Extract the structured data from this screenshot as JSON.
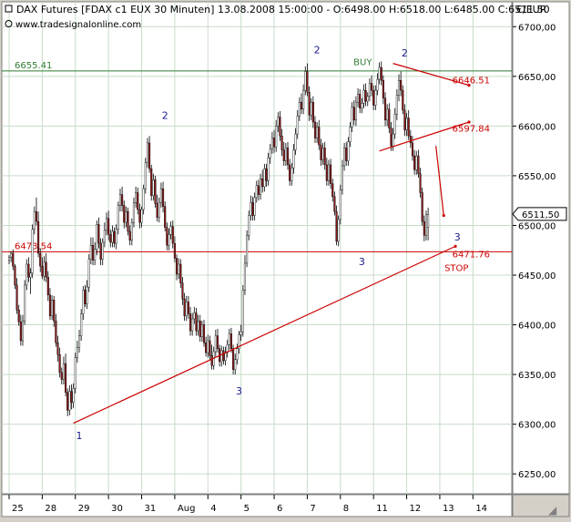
{
  "header": {
    "title": "DAX Futures [FDAX c1 EUX  30 Minuten] 13.08.2008 15:00:00 - O:6498.00 H:6518.00 L:6485.00 C:6511.50",
    "watermark": "www.tradesignalonline.com",
    "currency_label": "€/EUR"
  },
  "colors": {
    "background": "#ffffff",
    "frame": "#d4d0c8",
    "grid": "#c8dcc8",
    "candle_up": "#ffffff",
    "candle_down": "#8b1a1a",
    "candle_wick": "#000000",
    "resistance_line": "#2e7d32",
    "support_line": "#cc0000",
    "wave_label": "#1a1a8c",
    "buy_label": "#2e7d32",
    "level_label": "#cc0000"
  },
  "chart_data": {
    "type": "candlestick",
    "title": "DAX Futures [FDAX c1 EUX  30 Minuten]",
    "ylabel": "€/EUR",
    "ylim": [
      6230,
      6725
    ],
    "y_ticks": [
      6250,
      6300,
      6350,
      6400,
      6450,
      6500,
      6550,
      6600,
      6650,
      6700
    ],
    "y_tick_labels": [
      "6250,00",
      "6300,00",
      "6350,00",
      "6400,00",
      "6450,00",
      "6500,00",
      "6550,00",
      "6600,00",
      "6650,00",
      "6700,00"
    ],
    "x_labels": [
      "25",
      "28",
      "29",
      "30",
      "31",
      "Aug",
      "4",
      "5",
      "6",
      "7",
      "8",
      "11",
      "12",
      "13",
      "14"
    ],
    "x_label_index": [
      0,
      17,
      34,
      51,
      68,
      85,
      102,
      119,
      136,
      153,
      170,
      187,
      204,
      221,
      238
    ],
    "grid": true,
    "last_price": {
      "value": 6511.5,
      "label": "6511,50"
    },
    "horizontal_levels": [
      {
        "value": 6655.41,
        "label": "6655.41",
        "kind": "resistance"
      },
      {
        "value": 6473.54,
        "label": "6473.54",
        "kind": "support"
      }
    ],
    "trendlines": [
      {
        "name": "upper-support-trendline",
        "from": {
          "i": 33,
          "y": 6301
        },
        "to": {
          "i": 229,
          "y": 6479
        },
        "kind": "support"
      },
      {
        "name": "short-trendline-top",
        "from": {
          "i": 197,
          "y": 6663
        },
        "to": {
          "i": 236,
          "y": 6641
        },
        "kind": "support"
      },
      {
        "name": "short-trendline-mid",
        "from": {
          "i": 190,
          "y": 6575
        },
        "to": {
          "i": 236,
          "y": 6604
        },
        "kind": "support"
      },
      {
        "name": "drop-line",
        "from": {
          "i": 219,
          "y": 6580
        },
        "to": {
          "i": 223,
          "y": 6510
        },
        "kind": "support"
      }
    ],
    "price_annotations": [
      {
        "text": "6646.51",
        "i": 226,
        "y": 6646.51
      },
      {
        "text": "6597.84",
        "i": 226,
        "y": 6597.84
      },
      {
        "text": "6471.76",
        "i": 226,
        "y": 6471.76
      },
      {
        "text": "STOP",
        "i": 222,
        "y": 6458
      }
    ],
    "wave_labels": [
      {
        "text": "1",
        "i": 36,
        "y": 6285
      },
      {
        "text": "2",
        "i": 80,
        "y": 6607
      },
      {
        "text": "3",
        "i": 118,
        "y": 6330
      },
      {
        "text": "2",
        "i": 158,
        "y": 6673
      },
      {
        "text": "3",
        "i": 181,
        "y": 6460
      },
      {
        "text": "2",
        "i": 203,
        "y": 6670
      },
      {
        "text": "3",
        "i": 230,
        "y": 6485
      }
    ],
    "buy_marker": {
      "text": "BUY",
      "i": 187,
      "y": 6665
    },
    "candles": [
      [
        6465,
        6470,
        6461,
        6468
      ],
      [
        6468,
        6474,
        6463,
        6472
      ],
      [
        6472,
        6476,
        6455,
        6459
      ],
      [
        6459,
        6461,
        6436,
        6440
      ],
      [
        6440,
        6447,
        6411,
        6415
      ],
      [
        6415,
        6420,
        6399,
        6403
      ],
      [
        6403,
        6410,
        6379,
        6384
      ],
      [
        6384,
        6410,
        6379,
        6404
      ],
      [
        6404,
        6445,
        6400,
        6440
      ],
      [
        6440,
        6466,
        6435,
        6461
      ],
      [
        6461,
        6468,
        6443,
        6448
      ],
      [
        6448,
        6457,
        6431,
        6452
      ],
      [
        6452,
        6501,
        6447,
        6496
      ],
      [
        6496,
        6519,
        6491,
        6514
      ],
      [
        6514,
        6528,
        6500,
        6504
      ],
      [
        6504,
        6514,
        6468,
        6472
      ],
      [
        6472,
        6477,
        6453,
        6459
      ],
      [
        6459,
        6468,
        6446,
        6449
      ],
      [
        6449,
        6469,
        6444,
        6463
      ],
      [
        6463,
        6472,
        6443,
        6448
      ],
      [
        6448,
        6454,
        6424,
        6430
      ],
      [
        6430,
        6437,
        6405,
        6409
      ],
      [
        6409,
        6430,
        6405,
        6425
      ],
      [
        6425,
        6429,
        6398,
        6404
      ],
      [
        6404,
        6411,
        6378,
        6382
      ],
      [
        6382,
        6389,
        6363,
        6370
      ],
      [
        6370,
        6377,
        6347,
        6352
      ],
      [
        6352,
        6357,
        6340,
        6345
      ],
      [
        6345,
        6368,
        6340,
        6361
      ],
      [
        6361,
        6371,
        6328,
        6332
      ],
      [
        6332,
        6336,
        6308,
        6314
      ],
      [
        6314,
        6339,
        6309,
        6333
      ],
      [
        6333,
        6340,
        6315,
        6322
      ],
      [
        6322,
        6341,
        6316,
        6336
      ],
      [
        6336,
        6372,
        6331,
        6367
      ],
      [
        6367,
        6384,
        6362,
        6377
      ],
      [
        6377,
        6395,
        6372,
        6389
      ],
      [
        6389,
        6416,
        6384,
        6411
      ],
      [
        6411,
        6439,
        6405,
        6435
      ],
      [
        6435,
        6440,
        6418,
        6421
      ],
      [
        6421,
        6445,
        6416,
        6438
      ],
      [
        6438,
        6471,
        6433,
        6466
      ],
      [
        6466,
        6488,
        6461,
        6480
      ],
      [
        6480,
        6488,
        6460,
        6465
      ],
      [
        6465,
        6483,
        6460,
        6476
      ],
      [
        6476,
        6505,
        6470,
        6501
      ],
      [
        6501,
        6508,
        6477,
        6482
      ],
      [
        6482,
        6487,
        6460,
        6466
      ],
      [
        6466,
        6487,
        6460,
        6483
      ],
      [
        6483,
        6503,
        6478,
        6495
      ],
      [
        6495,
        6513,
        6490,
        6507
      ],
      [
        6507,
        6515,
        6485,
        6491
      ],
      [
        6491,
        6496,
        6478,
        6483
      ],
      [
        6483,
        6500,
        6478,
        6494
      ],
      [
        6494,
        6498,
        6478,
        6482
      ],
      [
        6482,
        6501,
        6476,
        6496
      ],
      [
        6496,
        6524,
        6491,
        6520
      ],
      [
        6520,
        6537,
        6514,
        6531
      ],
      [
        6531,
        6539,
        6514,
        6520
      ],
      [
        6520,
        6525,
        6497,
        6503
      ],
      [
        6503,
        6519,
        6498,
        6514
      ],
      [
        6514,
        6518,
        6490,
        6494
      ],
      [
        6494,
        6500,
        6480,
        6485
      ],
      [
        6485,
        6507,
        6480,
        6503
      ],
      [
        6503,
        6528,
        6498,
        6523
      ],
      [
        6523,
        6539,
        6518,
        6533
      ],
      [
        6533,
        6538,
        6511,
        6516
      ],
      [
        6516,
        6522,
        6497,
        6503
      ],
      [
        6503,
        6519,
        6498,
        6516
      ],
      [
        6516,
        6541,
        6511,
        6537
      ],
      [
        6537,
        6568,
        6532,
        6563
      ],
      [
        6563,
        6588,
        6558,
        6583
      ],
      [
        6583,
        6590,
        6553,
        6557
      ],
      [
        6557,
        6561,
        6525,
        6530
      ],
      [
        6530,
        6552,
        6525,
        6546
      ],
      [
        6546,
        6550,
        6518,
        6522
      ],
      [
        6522,
        6531,
        6504,
        6508
      ],
      [
        6508,
        6528,
        6503,
        6523
      ],
      [
        6523,
        6543,
        6518,
        6537
      ],
      [
        6537,
        6544,
        6513,
        6519
      ],
      [
        6519,
        6524,
        6494,
        6498
      ],
      [
        6498,
        6503,
        6475,
        6480
      ],
      [
        6480,
        6497,
        6475,
        6491
      ],
      [
        6491,
        6504,
        6486,
        6499
      ],
      [
        6499,
        6505,
        6477,
        6482
      ],
      [
        6482,
        6489,
        6463,
        6467
      ],
      [
        6467,
        6471,
        6445,
        6451
      ],
      [
        6451,
        6467,
        6446,
        6461
      ],
      [
        6461,
        6466,
        6437,
        6442
      ],
      [
        6442,
        6448,
        6420,
        6426
      ],
      [
        6426,
        6432,
        6404,
        6409
      ],
      [
        6409,
        6429,
        6404,
        6423
      ],
      [
        6423,
        6429,
        6406,
        6411
      ],
      [
        6411,
        6418,
        6389,
        6394
      ],
      [
        6394,
        6412,
        6389,
        6406
      ],
      [
        6406,
        6418,
        6401,
        6412
      ],
      [
        6412,
        6417,
        6389,
        6394
      ],
      [
        6394,
        6410,
        6389,
        6404
      ],
      [
        6404,
        6410,
        6383,
        6388
      ],
      [
        6388,
        6404,
        6383,
        6400
      ],
      [
        6400,
        6405,
        6378,
        6382
      ],
      [
        6382,
        6388,
        6368,
        6372
      ],
      [
        6372,
        6390,
        6367,
        6384
      ],
      [
        6384,
        6389,
        6365,
        6369
      ],
      [
        6369,
        6380,
        6355,
        6359
      ],
      [
        6359,
        6378,
        6355,
        6373
      ],
      [
        6373,
        6395,
        6368,
        6389
      ],
      [
        6389,
        6396,
        6372,
        6376
      ],
      [
        6376,
        6380,
        6358,
        6363
      ],
      [
        6363,
        6379,
        6358,
        6374
      ],
      [
        6374,
        6378,
        6360,
        6364
      ],
      [
        6364,
        6378,
        6359,
        6372
      ],
      [
        6372,
        6385,
        6367,
        6380
      ],
      [
        6380,
        6396,
        6375,
        6391
      ],
      [
        6391,
        6397,
        6372,
        6376
      ],
      [
        6376,
        6380,
        6350,
        6355
      ],
      [
        6355,
        6371,
        6350,
        6365
      ],
      [
        6365,
        6381,
        6360,
        6376
      ],
      [
        6376,
        6394,
        6371,
        6390
      ],
      [
        6390,
        6400,
        6384,
        6393
      ],
      [
        6393,
        6440,
        6388,
        6435
      ],
      [
        6435,
        6470,
        6430,
        6462
      ],
      [
        6462,
        6495,
        6458,
        6490
      ],
      [
        6490,
        6515,
        6485,
        6510
      ],
      [
        6510,
        6530,
        6505,
        6523
      ],
      [
        6523,
        6529,
        6505,
        6510
      ],
      [
        6510,
        6533,
        6505,
        6528
      ],
      [
        6528,
        6545,
        6523,
        6540
      ],
      [
        6540,
        6546,
        6525,
        6531
      ],
      [
        6531,
        6552,
        6526,
        6547
      ],
      [
        6547,
        6556,
        6533,
        6539
      ],
      [
        6539,
        6562,
        6534,
        6557
      ],
      [
        6557,
        6562,
        6539,
        6545
      ],
      [
        6545,
        6573,
        6540,
        6568
      ],
      [
        6568,
        6582,
        6562,
        6577
      ],
      [
        6577,
        6594,
        6572,
        6588
      ],
      [
        6588,
        6596,
        6573,
        6579
      ],
      [
        6579,
        6606,
        6574,
        6600
      ],
      [
        6600,
        6614,
        6594,
        6609
      ],
      [
        6609,
        6615,
        6585,
        6590
      ],
      [
        6590,
        6597,
        6570,
        6576
      ],
      [
        6576,
        6584,
        6560,
        6565
      ],
      [
        6565,
        6583,
        6560,
        6578
      ],
      [
        6578,
        6584,
        6556,
        6561
      ],
      [
        6561,
        6567,
        6540,
        6545
      ],
      [
        6545,
        6563,
        6540,
        6558
      ],
      [
        6558,
        6582,
        6552,
        6576
      ],
      [
        6576,
        6598,
        6571,
        6592
      ],
      [
        6592,
        6616,
        6587,
        6610
      ],
      [
        6610,
        6629,
        6605,
        6624
      ],
      [
        6624,
        6633,
        6612,
        6617
      ],
      [
        6617,
        6642,
        6612,
        6636
      ],
      [
        6636,
        6660,
        6631,
        6655
      ],
      [
        6655,
        6663,
        6630,
        6634
      ],
      [
        6634,
        6640,
        6605,
        6611
      ],
      [
        6611,
        6628,
        6606,
        6624
      ],
      [
        6624,
        6630,
        6598,
        6604
      ],
      [
        6604,
        6610,
        6583,
        6588
      ],
      [
        6588,
        6604,
        6583,
        6599
      ],
      [
        6599,
        6606,
        6576,
        6581
      ],
      [
        6581,
        6587,
        6560,
        6566
      ],
      [
        6566,
        6583,
        6561,
        6578
      ],
      [
        6578,
        6584,
        6556,
        6561
      ],
      [
        6561,
        6568,
        6540,
        6545
      ],
      [
        6545,
        6566,
        6540,
        6561
      ],
      [
        6561,
        6567,
        6537,
        6542
      ],
      [
        6542,
        6547,
        6524,
        6529
      ],
      [
        6529,
        6534,
        6510,
        6514
      ],
      [
        6514,
        6520,
        6480,
        6484
      ],
      [
        6484,
        6510,
        6479,
        6506
      ],
      [
        6506,
        6541,
        6501,
        6536
      ],
      [
        6536,
        6566,
        6531,
        6560
      ],
      [
        6560,
        6583,
        6555,
        6578
      ],
      [
        6578,
        6584,
        6560,
        6565
      ],
      [
        6565,
        6589,
        6560,
        6584
      ],
      [
        6584,
        6604,
        6579,
        6599
      ],
      [
        6599,
        6624,
        6594,
        6619
      ],
      [
        6619,
        6626,
        6601,
        6606
      ],
      [
        6606,
        6630,
        6600,
        6624
      ],
      [
        6624,
        6638,
        6619,
        6632
      ],
      [
        6632,
        6637,
        6613,
        6618
      ],
      [
        6618,
        6628,
        6613,
        6623
      ],
      [
        6623,
        6642,
        6618,
        6636
      ],
      [
        6636,
        6643,
        6620,
        6625
      ],
      [
        6625,
        6634,
        6620,
        6630
      ],
      [
        6630,
        6648,
        6625,
        6643
      ],
      [
        6643,
        6651,
        6630,
        6636
      ],
      [
        6636,
        6641,
        6616,
        6621
      ],
      [
        6621,
        6641,
        6616,
        6636
      ],
      [
        6636,
        6653,
        6631,
        6647
      ],
      [
        6647,
        6664,
        6642,
        6659
      ],
      [
        6659,
        6665,
        6641,
        6646
      ],
      [
        6646,
        6651,
        6622,
        6628
      ],
      [
        6628,
        6634,
        6600,
        6606
      ],
      [
        6606,
        6622,
        6600,
        6617
      ],
      [
        6617,
        6623,
        6593,
        6598
      ],
      [
        6598,
        6604,
        6575,
        6580
      ],
      [
        6580,
        6598,
        6575,
        6592
      ],
      [
        6592,
        6618,
        6587,
        6612
      ],
      [
        6612,
        6637,
        6606,
        6631
      ],
      [
        6631,
        6652,
        6625,
        6646
      ],
      [
        6646,
        6655,
        6630,
        6636
      ],
      [
        6636,
        6641,
        6612,
        6616
      ],
      [
        6616,
        6622,
        6590,
        6596
      ],
      [
        6596,
        6613,
        6590,
        6608
      ],
      [
        6608,
        6616,
        6586,
        6590
      ],
      [
        6590,
        6596,
        6578,
        6583
      ],
      [
        6583,
        6590,
        6565,
        6570
      ],
      [
        6570,
        6576,
        6551,
        6556
      ],
      [
        6556,
        6575,
        6551,
        6570
      ],
      [
        6570,
        6576,
        6548,
        6552
      ],
      [
        6552,
        6558,
        6528,
        6533
      ],
      [
        6533,
        6538,
        6500,
        6504
      ],
      [
        6504,
        6510,
        6484,
        6490
      ],
      [
        6490,
        6515,
        6485,
        6511
      ],
      [
        6498,
        6518,
        6485,
        6511
      ]
    ]
  }
}
